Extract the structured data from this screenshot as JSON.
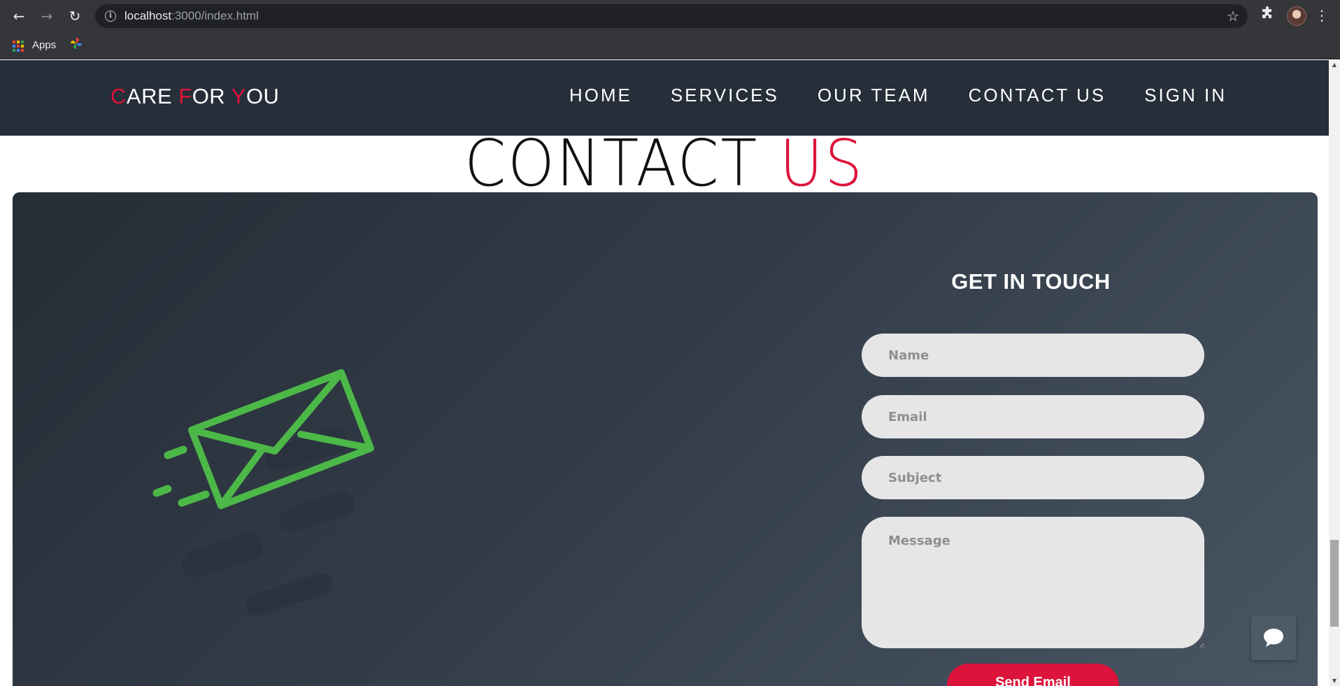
{
  "browser": {
    "url_host": "localhost",
    "url_path": ":3000/index.html",
    "bookmarks": [
      {
        "label": "Apps",
        "icon": "apps-grid-icon"
      },
      {
        "label": "",
        "icon": "pinwheel-icon"
      }
    ]
  },
  "header": {
    "logo": {
      "parts": [
        {
          "text": "C",
          "accent": true
        },
        {
          "text": "ARE ",
          "accent": false
        },
        {
          "text": "F",
          "accent": true
        },
        {
          "text": "OR ",
          "accent": false
        },
        {
          "text": "Y",
          "accent": true
        },
        {
          "text": "OU",
          "accent": false
        }
      ]
    },
    "nav": [
      {
        "label": "HOME"
      },
      {
        "label": "SERVICES"
      },
      {
        "label": "OUR TEAM"
      },
      {
        "label": "CONTACT US"
      },
      {
        "label": "SIGN IN"
      }
    ]
  },
  "section": {
    "title_main": "CONTACT ",
    "title_highlight": "US"
  },
  "contact_form": {
    "title": "GET IN TOUCH",
    "name_placeholder": "Name",
    "email_placeholder": "Email",
    "subject_placeholder": "Subject",
    "message_placeholder": "Message",
    "send_label": "Send Email"
  },
  "colors": {
    "accent": "#dc143c",
    "header_bg": "#262e39",
    "envelope_green": "#4cb848",
    "field_bg": "#e6e6e6"
  },
  "icons": {
    "envelope": "envelope-icon",
    "chat": "chat-bubble-icon"
  }
}
